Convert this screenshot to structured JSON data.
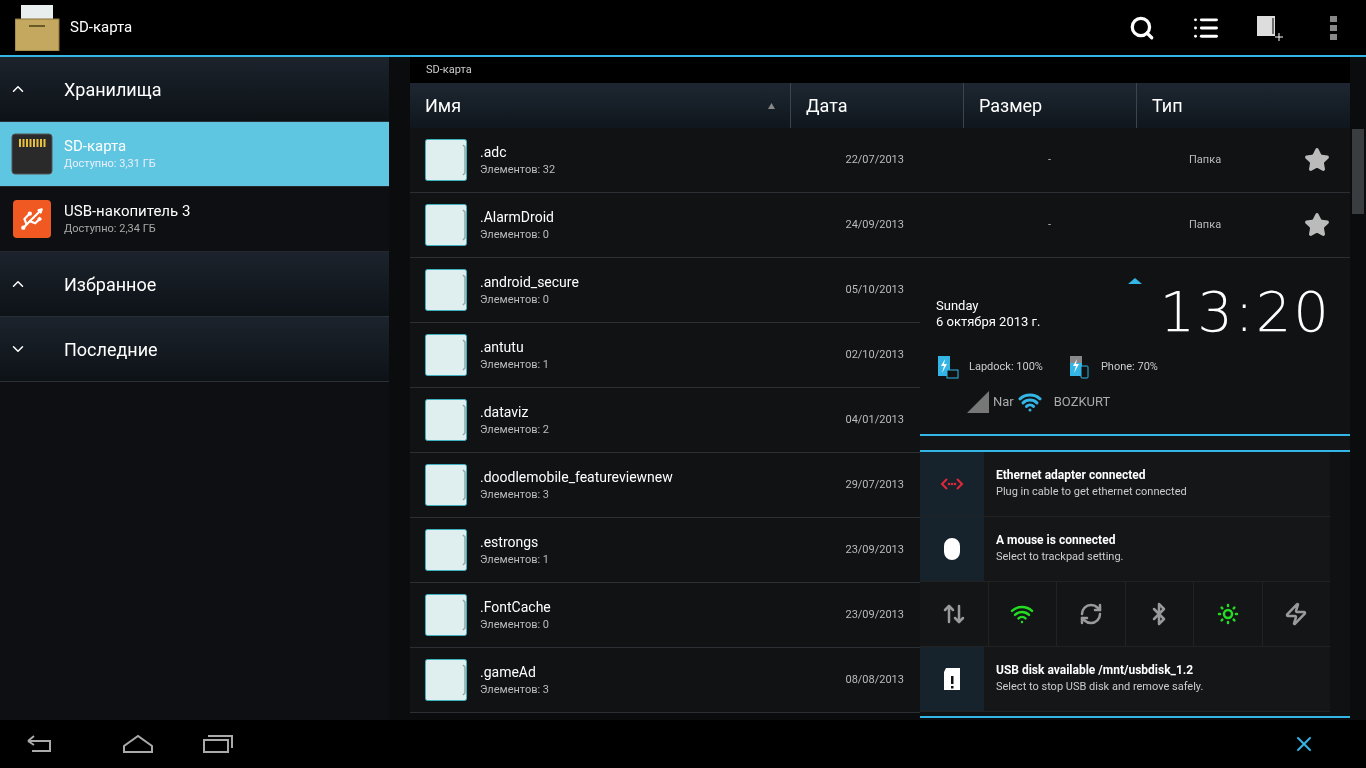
{
  "action_bar": {
    "title": "SD-карта"
  },
  "sidebar": {
    "sections": [
      {
        "title": "Хранилища",
        "expanded": true,
        "items": [
          {
            "kind": "sdcard",
            "name": "SD-карта",
            "detail": "Доступно: 3,31 ГБ",
            "selected": true
          },
          {
            "kind": "usb",
            "name": "USB-накопитель 3",
            "detail": "Доступно: 2,34 ГБ",
            "selected": false
          }
        ]
      },
      {
        "title": "Избранное",
        "expanded": true
      },
      {
        "title": "Последние",
        "expanded": false
      }
    ]
  },
  "breadcrumb": "SD-карта",
  "table": {
    "columns": [
      {
        "label": "Имя",
        "sorted": true
      },
      {
        "label": "Дата",
        "sorted": false
      },
      {
        "label": "Размер",
        "sorted": false
      },
      {
        "label": "Тип",
        "sorted": false
      }
    ],
    "rows": [
      {
        "name": ".adc",
        "count": "Элементов: 32",
        "date": "22/07/2013",
        "size": "-",
        "type": "Папка"
      },
      {
        "name": ".AlarmDroid",
        "count": "Элементов: 0",
        "date": "24/09/2013",
        "size": "-",
        "type": "Папка"
      },
      {
        "name": ".android_secure",
        "count": "Элементов: 0",
        "date": "05/10/2013"
      },
      {
        "name": ".antutu",
        "count": "Элементов: 1",
        "date": "02/10/2013"
      },
      {
        "name": ".dataviz",
        "count": "Элементов: 2",
        "date": "04/01/2013"
      },
      {
        "name": ".doodlemobile_featureviewnew",
        "count": "Элементов: 3",
        "date": "29/07/2013"
      },
      {
        "name": ".estrongs",
        "count": "Элементов: 1",
        "date": "23/09/2013"
      },
      {
        "name": ".FontCache",
        "count": "Элементов: 0",
        "date": "23/09/2013"
      },
      {
        "name": ".gameAd",
        "count": "Элементов: 3",
        "date": "08/08/2013"
      }
    ]
  },
  "notification_panel": {
    "day": "Sunday",
    "date": "6 октября 2013 г.",
    "time": "13:20",
    "batteries": [
      {
        "kind": "laptop",
        "label": "Lapdock: 100%"
      },
      {
        "kind": "phone",
        "label": "Phone: 70%"
      }
    ],
    "carrier": "Nar",
    "wifi_name": "BOZKURT",
    "notifications": [
      {
        "kind": "ethernet",
        "title": "Ethernet adapter connected",
        "text": "Plug in cable to get ethernet connected"
      },
      {
        "kind": "mouse",
        "title": "A mouse is connected",
        "text": "Select to trackpad setting."
      },
      {
        "kind": "toggles",
        "toggles": [
          {
            "kind": "data",
            "on": false
          },
          {
            "kind": "wifi",
            "on": true
          },
          {
            "kind": "sync",
            "on": false
          },
          {
            "kind": "bluetooth",
            "on": false
          },
          {
            "kind": "brightness",
            "on": true
          },
          {
            "kind": "power",
            "on": false
          }
        ]
      },
      {
        "kind": "sdcard",
        "title": "USB disk available /mnt/usbdisk_1.2",
        "text": "Select to stop USB disk and remove safely."
      }
    ]
  }
}
